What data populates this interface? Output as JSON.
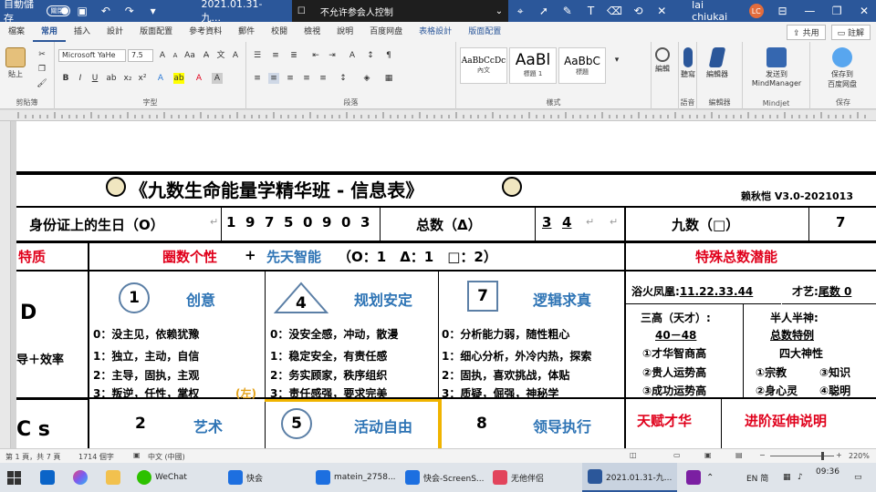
{
  "titlebar": {
    "autosave_label": "自動儲存",
    "autosave_state": "關閉",
    "doc_title": "2021.01.31-九...",
    "control_banner": "不允许参会人控制",
    "user_name": "lai chiukai",
    "user_initials": "LC"
  },
  "tabs": [
    "檔案",
    "常用",
    "插入",
    "設計",
    "版面配置",
    "參考資料",
    "郵件",
    "校閱",
    "檢視",
    "說明",
    "百度网盘",
    "表格設計",
    "版面配置"
  ],
  "share_label": "共用",
  "comment_label": "註解",
  "ribbon": {
    "paste_label": "貼上",
    "clipboard_group": "剪貼簿",
    "font_name": "Microsoft YaHe",
    "font_size": "7.5",
    "font_group": "字型",
    "paragraph_group": "段落",
    "styles": [
      {
        "preview": "AaBbCcDc",
        "name": "內文"
      },
      {
        "preview": "AaBl",
        "name": "標題 1"
      },
      {
        "preview": "AaBbC",
        "name": "標題"
      }
    ],
    "styles_group": "樣式",
    "edit_label": "編輯",
    "dictate_label": "聽寫",
    "voice_group": "語音",
    "editor_label": "編輯器",
    "editor_group": "編輯器",
    "mindjet_label_1": "发送到",
    "mindjet_label_2": "MindManager",
    "mindjet_group": "Mindjet",
    "save_baidu_1": "保存到",
    "save_baidu_2": "百度网盘",
    "save_group": "保存"
  },
  "doc": {
    "title": "《九数生命能量学精华班 - 信息表》",
    "version": "赖秋恺 V3.0-2021013",
    "birth_label": "身份证上的生日（O）",
    "birth_digits": [
      "1",
      "9",
      "7",
      "5",
      "0",
      "9",
      "0",
      "3"
    ],
    "total_label": "总数（Δ）",
    "total_digits": [
      "3",
      "4"
    ],
    "nine_label": "九数（□）",
    "nine_value": "7",
    "trait_label": "特质",
    "personality_label": "圈数个性",
    "plus": "+",
    "innate_label": "先天智能",
    "counts": "（O：1　Δ：1　□：2）",
    "special_label": "特殊总数潜能",
    "row_d": "D",
    "row_lead": "导＋效率",
    "row_cs": "C s",
    "col1": {
      "num": "1",
      "title": "创意",
      "lines": [
        "0：没主见，依赖犹豫",
        "1：独立，主动，自信",
        "2：主导，固执，主观",
        "3：叛逆，任性，掌权"
      ],
      "tag": "(左)"
    },
    "col2": {
      "num": "4",
      "title": "规划安定",
      "lines": [
        "0：没安全感，冲动，散漫",
        "1：稳定安全，有责任感",
        "2：务实顾家，秩序组织",
        "3：责任感强，要求完美"
      ]
    },
    "col3": {
      "num": "7",
      "title": "逻辑求真",
      "lines": [
        "0：分析能力弱，随性粗心",
        "1：细心分析，外冷内热，探索",
        "2：固执，喜欢挑战，体贴",
        "3：质疑，倔强，神秘学"
      ]
    },
    "phoenix": "浴火凤凰:",
    "phoenix_nums": "11.22.33.44",
    "talent": "才艺:",
    "talent_num": "尾数 0",
    "three_high": "三高（天才）:",
    "three_high_nums": "40－48",
    "three_high_items": [
      "①才华智商高",
      "②贵人运势高",
      "③成功运势高"
    ],
    "half_god": "半人半神:",
    "half_god_sub": "总数特例",
    "four_god": "四大神性",
    "four_god_items": [
      "①宗教",
      "③知识",
      "②身心灵",
      "④聪明"
    ],
    "row2": [
      {
        "num": "2",
        "title": "艺术"
      },
      {
        "num": "5",
        "title": "活动自由"
      },
      {
        "num": "8",
        "title": "领导执行"
      }
    ],
    "gift_label": "天赋才华",
    "advanced_label": "进阶延伸说明"
  },
  "status": {
    "page": "第 1 頁，共 7 頁",
    "words": "1714 個字",
    "lang": "中文 (中國)",
    "zoom": "220%"
  },
  "taskbar": {
    "apps": [
      "WeChat",
      "快会",
      "matein_2758...",
      "快会-ScreenS...",
      "无他伴侣",
      "2021.01.31-九..."
    ],
    "ime": "EN 简",
    "time": "09:36"
  }
}
